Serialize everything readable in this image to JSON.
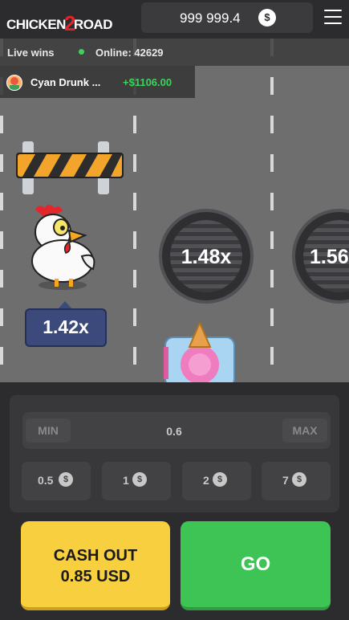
{
  "header": {
    "logo_text_a": "CHICKEN",
    "logo_text_num": "2",
    "logo_text_b": "ROAD",
    "balance": "999 999.4",
    "currency_symbol": "$",
    "menu_icon": "hamburger-menu-icon"
  },
  "live": {
    "label": "Live wins",
    "online_label": "Online: 42629",
    "winner_name": "Cyan Drunk ...",
    "winner_amount": "+$1106.00"
  },
  "road": {
    "chicken_multiplier": "1.42x",
    "lane_multipliers": [
      "1.48x",
      "1.56"
    ]
  },
  "controls": {
    "min_label": "MIN",
    "max_label": "MAX",
    "bet_amount": "0.6",
    "chips": [
      "0.5",
      "1",
      "2",
      "7"
    ],
    "chip_currency": "$",
    "cashout_line1": "CASH OUT",
    "cashout_line2": "0.85 USD",
    "go_label": "GO"
  },
  "colors": {
    "go": "#3ec455",
    "cashout": "#f7cf3f",
    "win_amount": "#3ad45a",
    "logo_accent": "#e0242b"
  }
}
